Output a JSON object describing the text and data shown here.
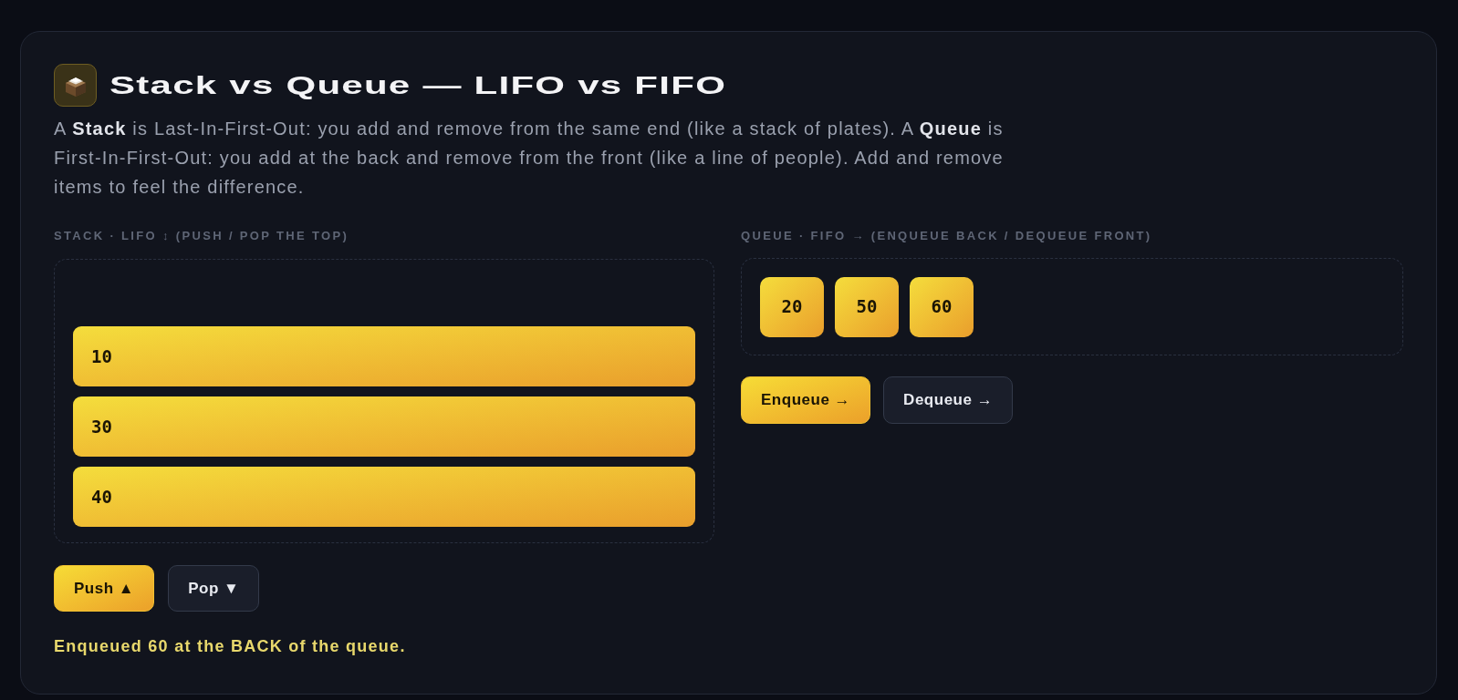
{
  "header": {
    "title": "Stack vs Queue — LIFO vs FIFO",
    "description": "A **Stack** is Last-In-First-Out: you add and remove from the same end (like a stack of plates). A **Queue** is First-In-First-Out: you add at the back and remove from the front (like a line of people). Add and remove items to feel the difference."
  },
  "stack": {
    "label": "STACK · LIFO ↕ (PUSH / POP THE TOP)",
    "items": [
      {
        "value": "10"
      },
      {
        "value": "30"
      },
      {
        "value": "40"
      }
    ],
    "buttons": [
      {
        "label": "Push ▲",
        "kind": "primary"
      },
      {
        "label": "Pop ▼",
        "kind": "secondary"
      }
    ]
  },
  "queue": {
    "label": "QUEUE · FIFO → (ENQUEUE BACK / DEQUEUE FRONT)",
    "items": [
      {
        "value": "20"
      },
      {
        "value": "50"
      },
      {
        "value": "60"
      }
    ],
    "buttons": [
      {
        "label": "Enqueue →",
        "kind": "primary"
      },
      {
        "label": "Dequeue →",
        "kind": "secondary"
      }
    ]
  },
  "status": "Enqueued 60 at the BACK of the queue."
}
